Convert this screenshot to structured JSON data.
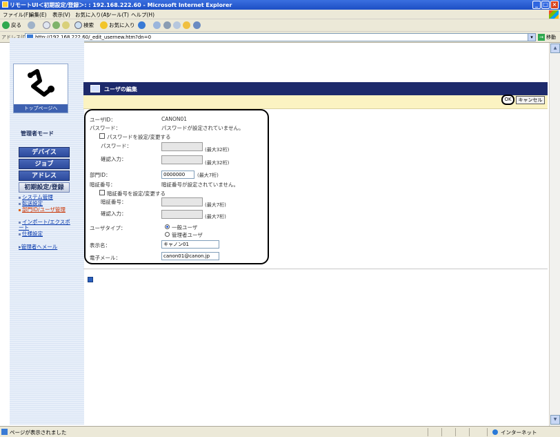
{
  "window": {
    "title": "リモートUI＜初期設定/登録＞: : 192.168.222.60 - Microsoft Internet Explorer"
  },
  "menu": [
    "ファイル(F)",
    "編集(E)",
    "表示(V)",
    "お気に入り(A)",
    "ツール(T)",
    "ヘルプ(H)"
  ],
  "toolbar": {
    "back": "戻る",
    "search": "検索",
    "favorites": "お気に入り"
  },
  "address": {
    "label": "アドレス(D)",
    "url": "http://192.168.222.60/_edit_usernew.htm?dn=0",
    "go": "移動"
  },
  "sidebar": {
    "logo_label": "トップページへ",
    "mode": "管理者モード",
    "nav": [
      "デバイス",
      "ジョブ",
      "アドレス",
      "初期設定/登録"
    ],
    "sublinks": [
      {
        "label": "システム管理",
        "current": false
      },
      {
        "label": "転送設定",
        "current": false
      },
      {
        "label": "部門ID/ユーザ管理",
        "current": true
      },
      {
        "label": "インポート/エクスポート",
        "current": false
      },
      {
        "label": "仕様設定",
        "current": false
      }
    ],
    "mail": "管理者へメール"
  },
  "page": {
    "title": "ユーザの編集",
    "ok": "OK",
    "cancel": "キャンセル"
  },
  "form": {
    "user_id_label": "ユーザID：",
    "user_id": "CANON01",
    "password_label": "パスワード：",
    "password_status": "パスワードが設定されていません。",
    "password_checkbox": "パスワードを設定/変更する",
    "pw_field_label": "パスワード：",
    "pw_hint": "(最大32桁)",
    "pw_confirm_label": "確認入力：",
    "pw_confirm_hint": "(最大32桁)",
    "dept_label": "部門ID：",
    "dept_value": "0000000",
    "dept_hint": "(最大7桁)",
    "pin_label": "暗証番号：",
    "pin_status": "暗証番号が設定されていません。",
    "pin_checkbox": "暗証番号を設定/変更する",
    "pin_field_label": "暗証番号：",
    "pin_hint": "(最大7桁)",
    "pin_confirm_label": "確認入力：",
    "pin_confirm_hint": "(最大7桁)",
    "usertype_label": "ユーザタイプ：",
    "usertype_general": "一般ユーザ",
    "usertype_admin": "管理者ユーザ",
    "display_name_label": "表示名：",
    "display_name": "キャノン01",
    "email_label": "電子メール：",
    "email": "canon01@canon.jp"
  },
  "status": {
    "text": "ページが表示されました",
    "zone": "インターネット"
  }
}
